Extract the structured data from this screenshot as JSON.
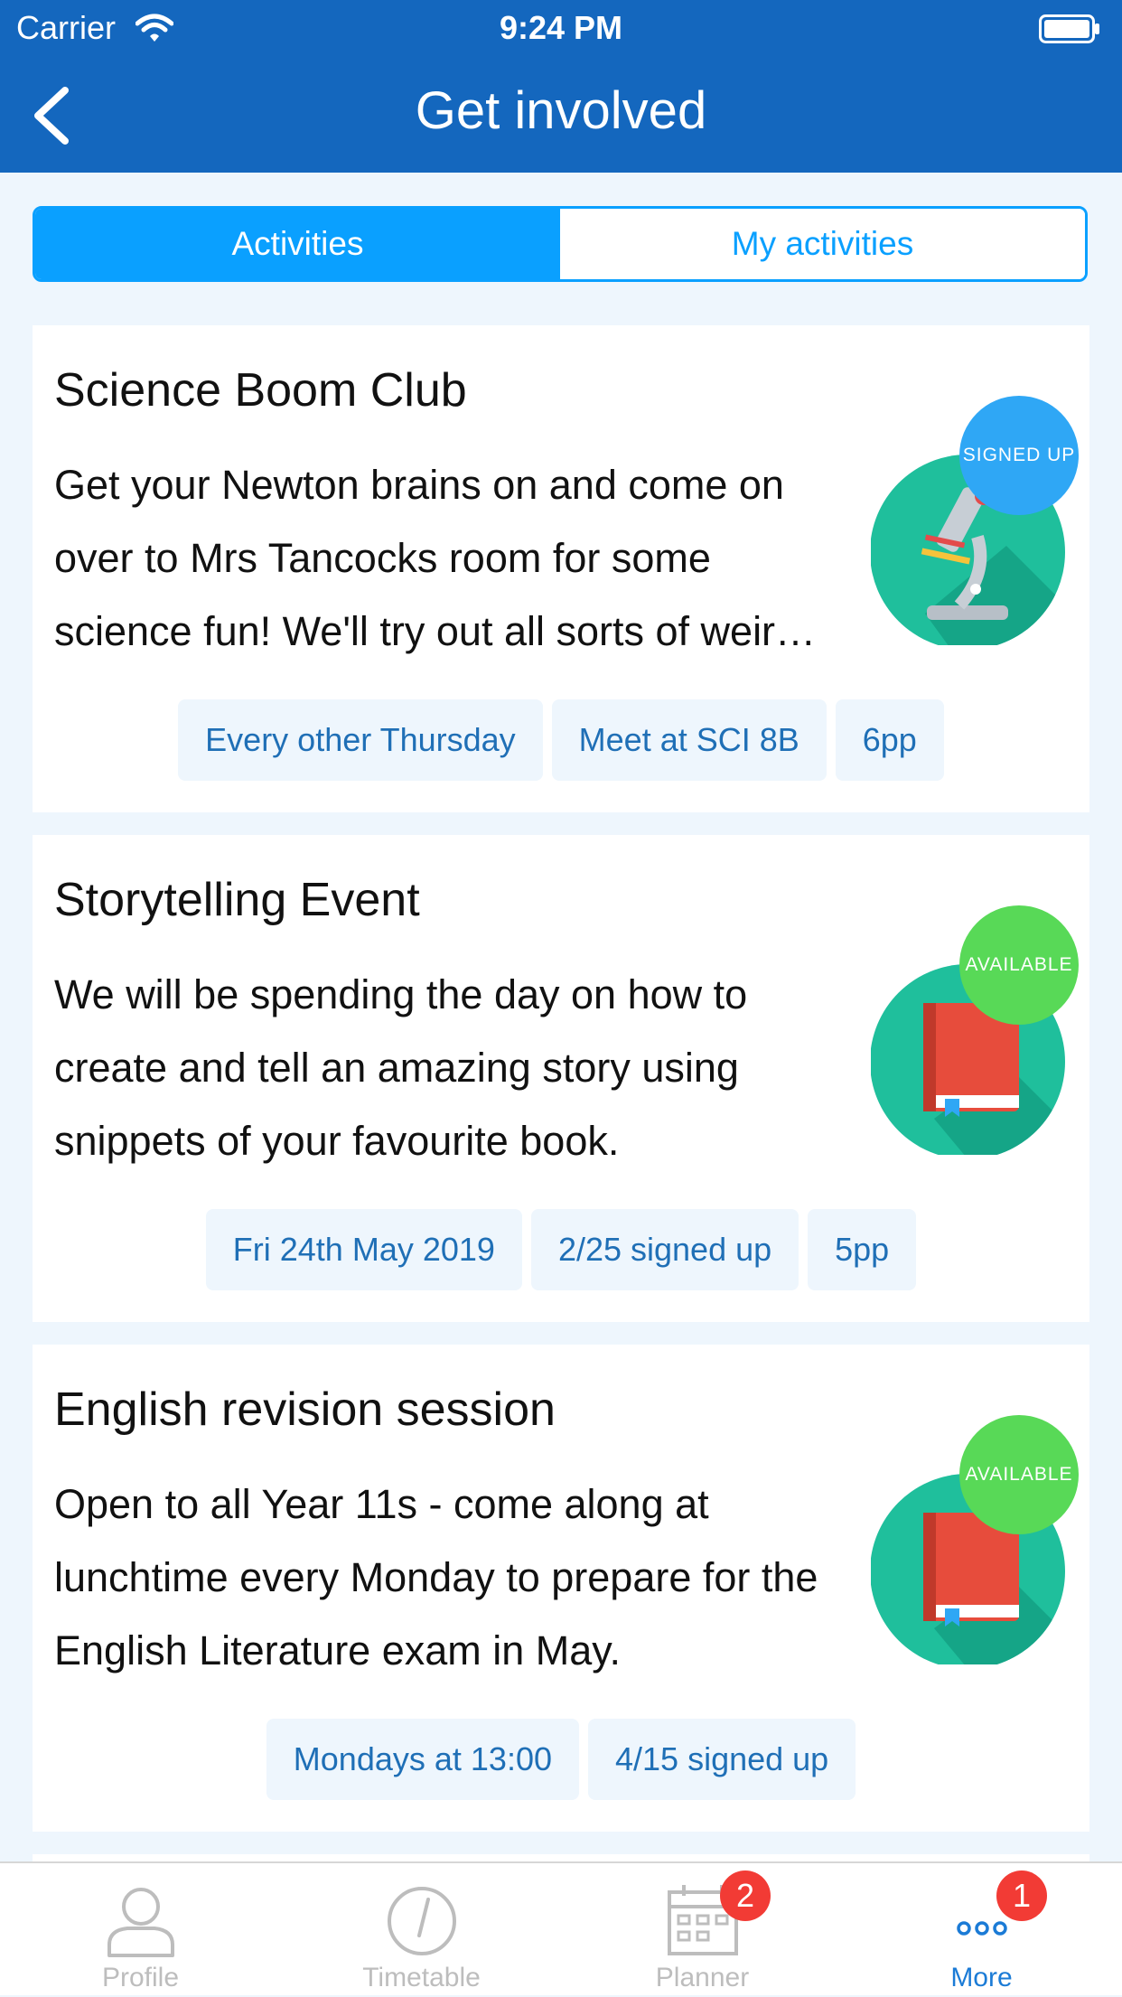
{
  "status_bar": {
    "carrier": "Carrier",
    "time": "9:24 PM"
  },
  "nav": {
    "title": "Get involved"
  },
  "segment": {
    "tabs": [
      "Activities",
      "My activities"
    ]
  },
  "colors": {
    "brand": "#1467be",
    "accent": "#0aa0ff",
    "signed_up": "#2fa7f5",
    "available": "#58d957",
    "badge": "#f23b35"
  },
  "activities": [
    {
      "title": "Science Boom Club",
      "desc": [
        "Get your Newton brains on and come on",
        "over to Mrs Tancocks room for some",
        "science fun! We'll try out all sorts of weir…"
      ],
      "status": "SIGNED UP",
      "icon": "microscope-icon",
      "tags": [
        "Every other Thursday",
        "Meet at SCI 8B",
        "6pp"
      ]
    },
    {
      "title": "Storytelling Event",
      "desc": [
        "We will be spending the day on how to",
        "create and tell an amazing story using",
        "snippets of your favourite book."
      ],
      "status": "AVAILABLE",
      "icon": "book-icon",
      "tags": [
        "Fri 24th May 2019",
        "2/25 signed up",
        "5pp"
      ]
    },
    {
      "title": "English revision session",
      "desc": [
        "Open to all Year 11s - come along at",
        "lunchtime every Monday to prepare for the",
        "English Literature exam in May."
      ],
      "status": "AVAILABLE",
      "icon": "book-icon",
      "tags": [
        "Mondays at 13:00",
        "4/15 signed up"
      ]
    }
  ],
  "tabbar": {
    "tabs": [
      {
        "label": "Profile",
        "icon": "profile-icon"
      },
      {
        "label": "Timetable",
        "icon": "clock-icon"
      },
      {
        "label": "Planner",
        "icon": "calendar-icon",
        "badge": "2"
      },
      {
        "label": "More",
        "icon": "more-icon",
        "badge": "1"
      }
    ]
  }
}
